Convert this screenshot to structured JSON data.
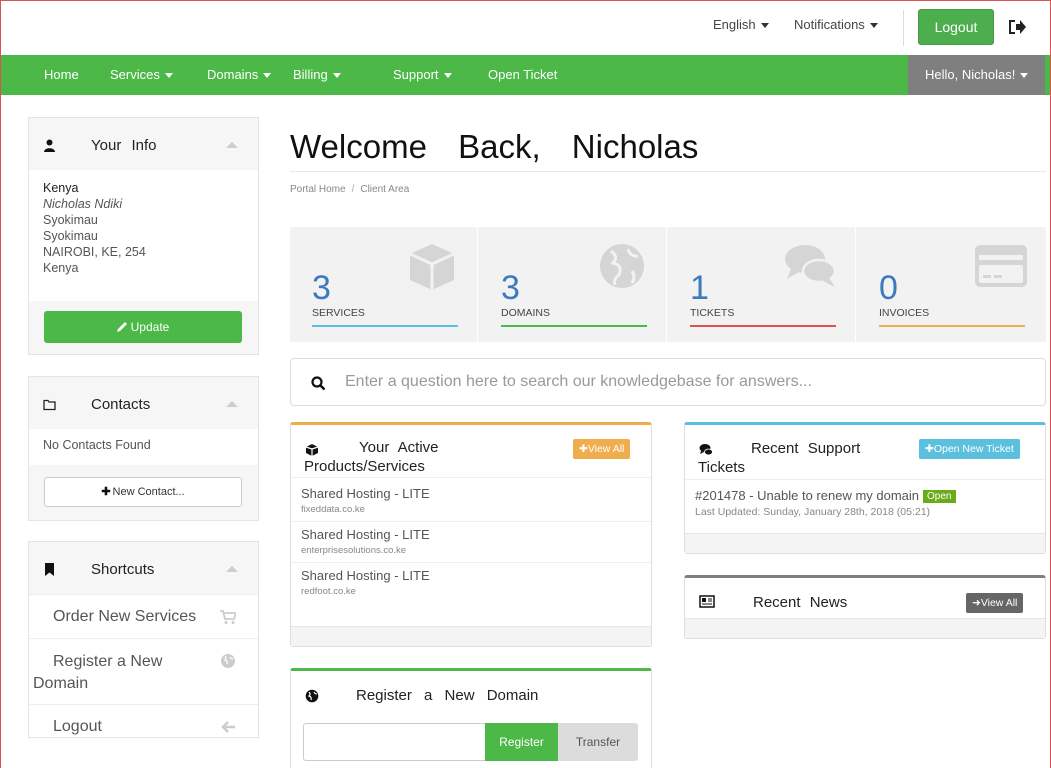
{
  "topbar": {
    "language": "English",
    "notifications": "Notifications",
    "logout": "Logout"
  },
  "nav": {
    "items": [
      "Home",
      "Services",
      "Domains",
      "Billing",
      "Support",
      "Open Ticket"
    ],
    "user": "Hello, Nicholas!"
  },
  "sidebar": {
    "info": {
      "title": "Your Info",
      "lines": [
        "Kenya",
        "Nicholas Ndiki",
        "Syokimau",
        "Syokimau",
        "NAIROBI, KE, 254",
        "Kenya"
      ],
      "update": "Update"
    },
    "contacts": {
      "title": "Contacts",
      "empty": "No Contacts Found",
      "new": "New Contact..."
    },
    "shortcuts": {
      "title": "Shortcuts",
      "items": [
        "Order New Services",
        "Register a New",
        "Domain",
        "Logout"
      ]
    }
  },
  "main": {
    "welcome": "Welcome Back, Nicholas",
    "breadcrumb": [
      "Portal Home",
      "Client Area"
    ],
    "tiles": [
      {
        "value": "3",
        "label": "SERVICES",
        "color": "#5bc0de"
      },
      {
        "value": "3",
        "label": "DOMAINS",
        "color": "#4cb848"
      },
      {
        "value": "1",
        "label": "TICKETS",
        "color": "#d9534f"
      },
      {
        "value": "0",
        "label": "INVOICES",
        "color": "#f0ad4e"
      }
    ],
    "kb_placeholder": "Enter a question here to search our knowledgebase for answers...",
    "products": {
      "title_line1": "Your Active",
      "title_line2": "Products/Services",
      "view_all": "View All",
      "rows": [
        {
          "name": "Shared Hosting - LITE",
          "domain": "fixeddata.co.ke"
        },
        {
          "name": "Shared Hosting - LITE",
          "domain": "enterprisesolutions.co.ke"
        },
        {
          "name": "Shared Hosting - LITE",
          "domain": "redfoot.co.ke"
        }
      ]
    },
    "tickets": {
      "title_line1": "Recent Support",
      "title_line2": "Tickets",
      "open_new": "Open New Ticket",
      "ticket": "#201478 - Unable to renew my domain",
      "status": "Open",
      "updated": "Last Updated: Sunday, January 28th, 2018 (05:21)"
    },
    "news": {
      "title": "Recent News",
      "view_all": "View All"
    },
    "register_domain": {
      "title": "Register a New Domain",
      "register": "Register",
      "transfer": "Transfer"
    }
  },
  "colors": {
    "brand_green": "#4cb848",
    "info_blue": "#5bc0de",
    "warning_orange": "#f0ad4e",
    "danger_red": "#d9534f"
  }
}
